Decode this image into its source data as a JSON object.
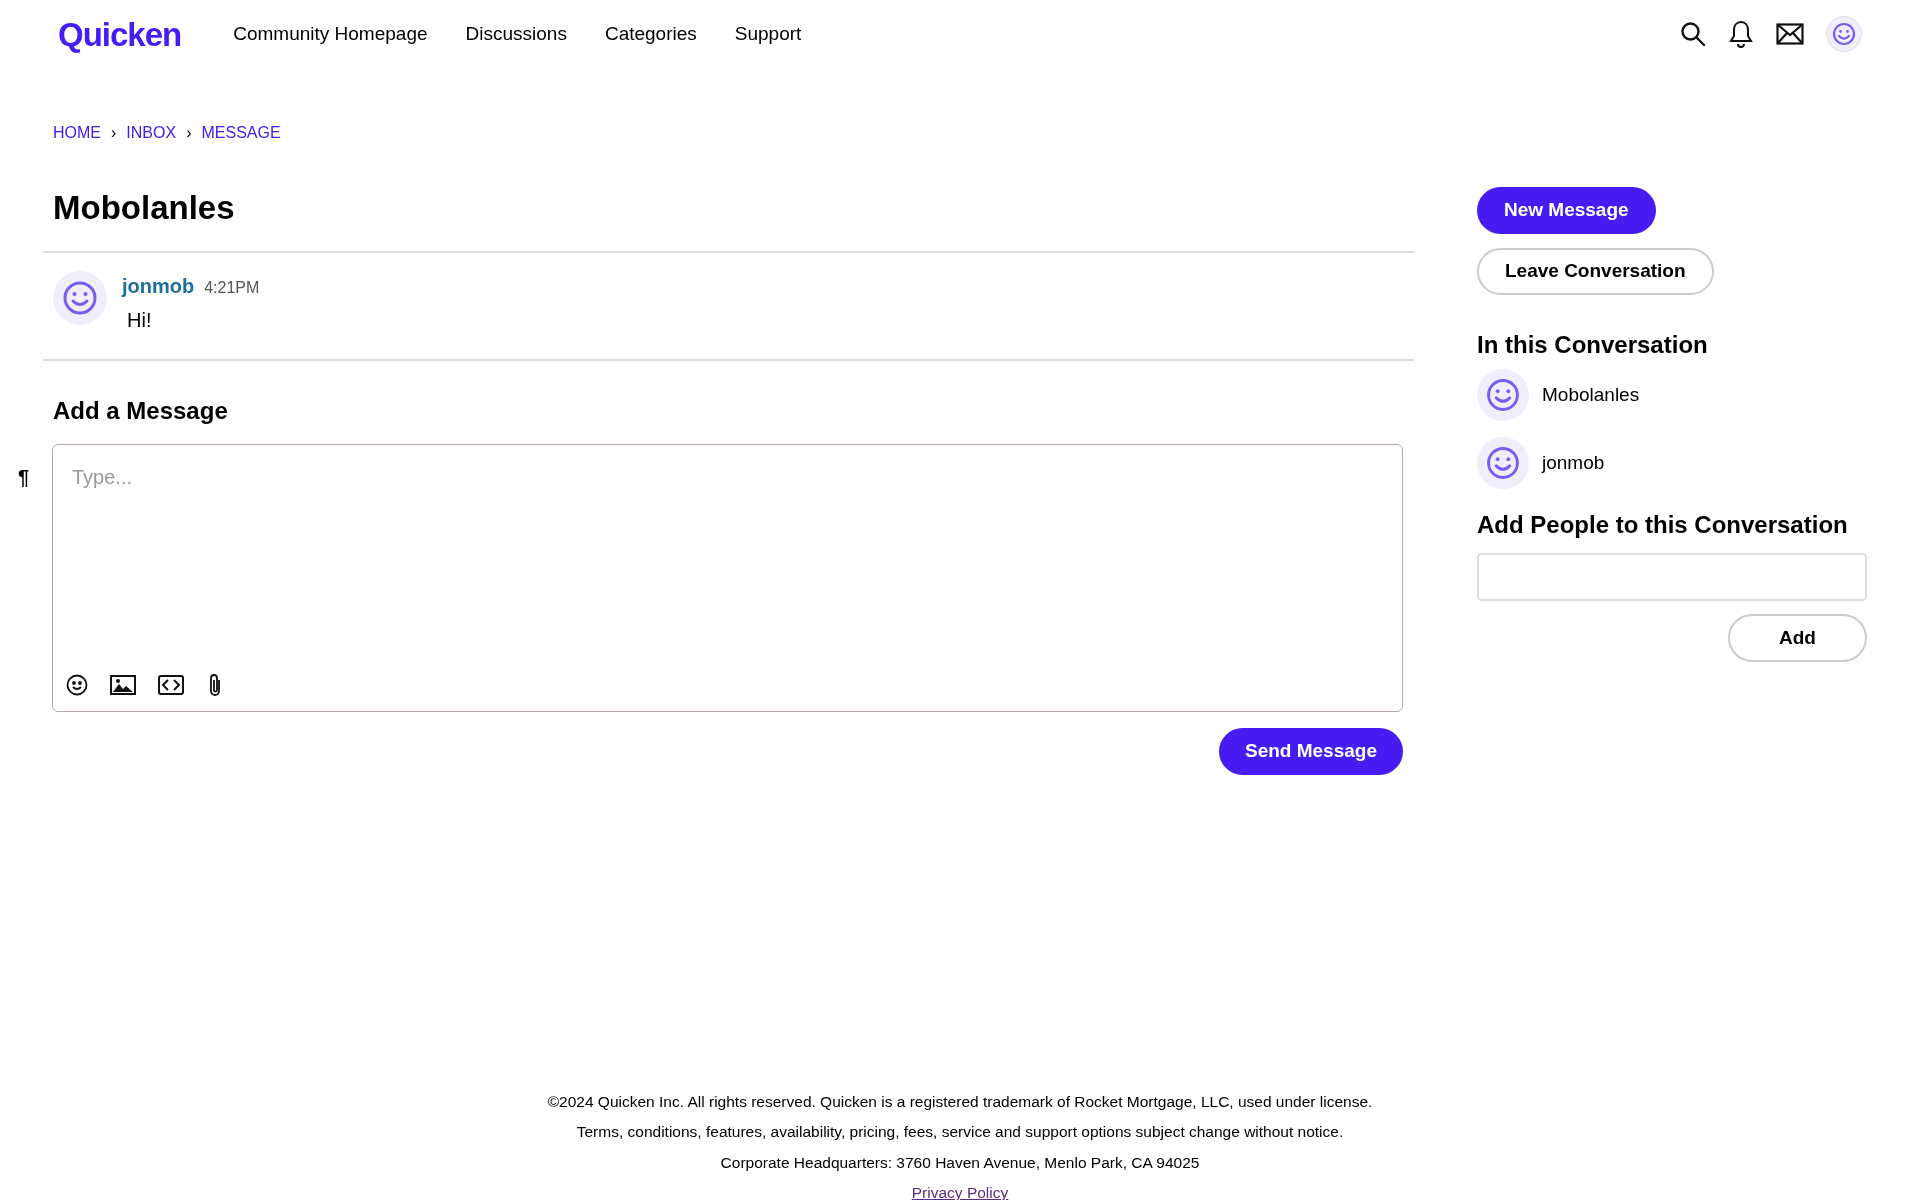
{
  "header": {
    "logo": "Quicken",
    "nav": [
      "Community Homepage",
      "Discussions",
      "Categories",
      "Support"
    ]
  },
  "breadcrumb": [
    "HOME",
    "INBOX",
    "MESSAGE"
  ],
  "breadcrumb_separator": "›",
  "conversation": {
    "title": "Mobolanles",
    "messages": [
      {
        "author": "jonmob",
        "time": "4:21PM",
        "body": "Hi!"
      }
    ]
  },
  "compose": {
    "heading": "Add a Message",
    "format_marker": "¶",
    "placeholder": "Type...",
    "send_button": "Send Message"
  },
  "sidebar": {
    "new_button": "New Message",
    "leave_button": "Leave Conversation",
    "participants_heading": "In this Conversation",
    "participants": [
      "Mobolanles",
      "jonmob"
    ],
    "add_heading": "Add People to this Conversation",
    "add_button": "Add"
  },
  "footer": {
    "lines": [
      "©2024 Quicken Inc. All rights reserved. Quicken is a registered trademark of Rocket Mortgage, LLC, used under license.",
      "Terms, conditions, features, availability, pricing, fees, service and support options subject change without notice.",
      "Corporate Headquarters: 3760 Haven Avenue, Menlo Park, CA 94025"
    ],
    "link": "Privacy Policy"
  }
}
